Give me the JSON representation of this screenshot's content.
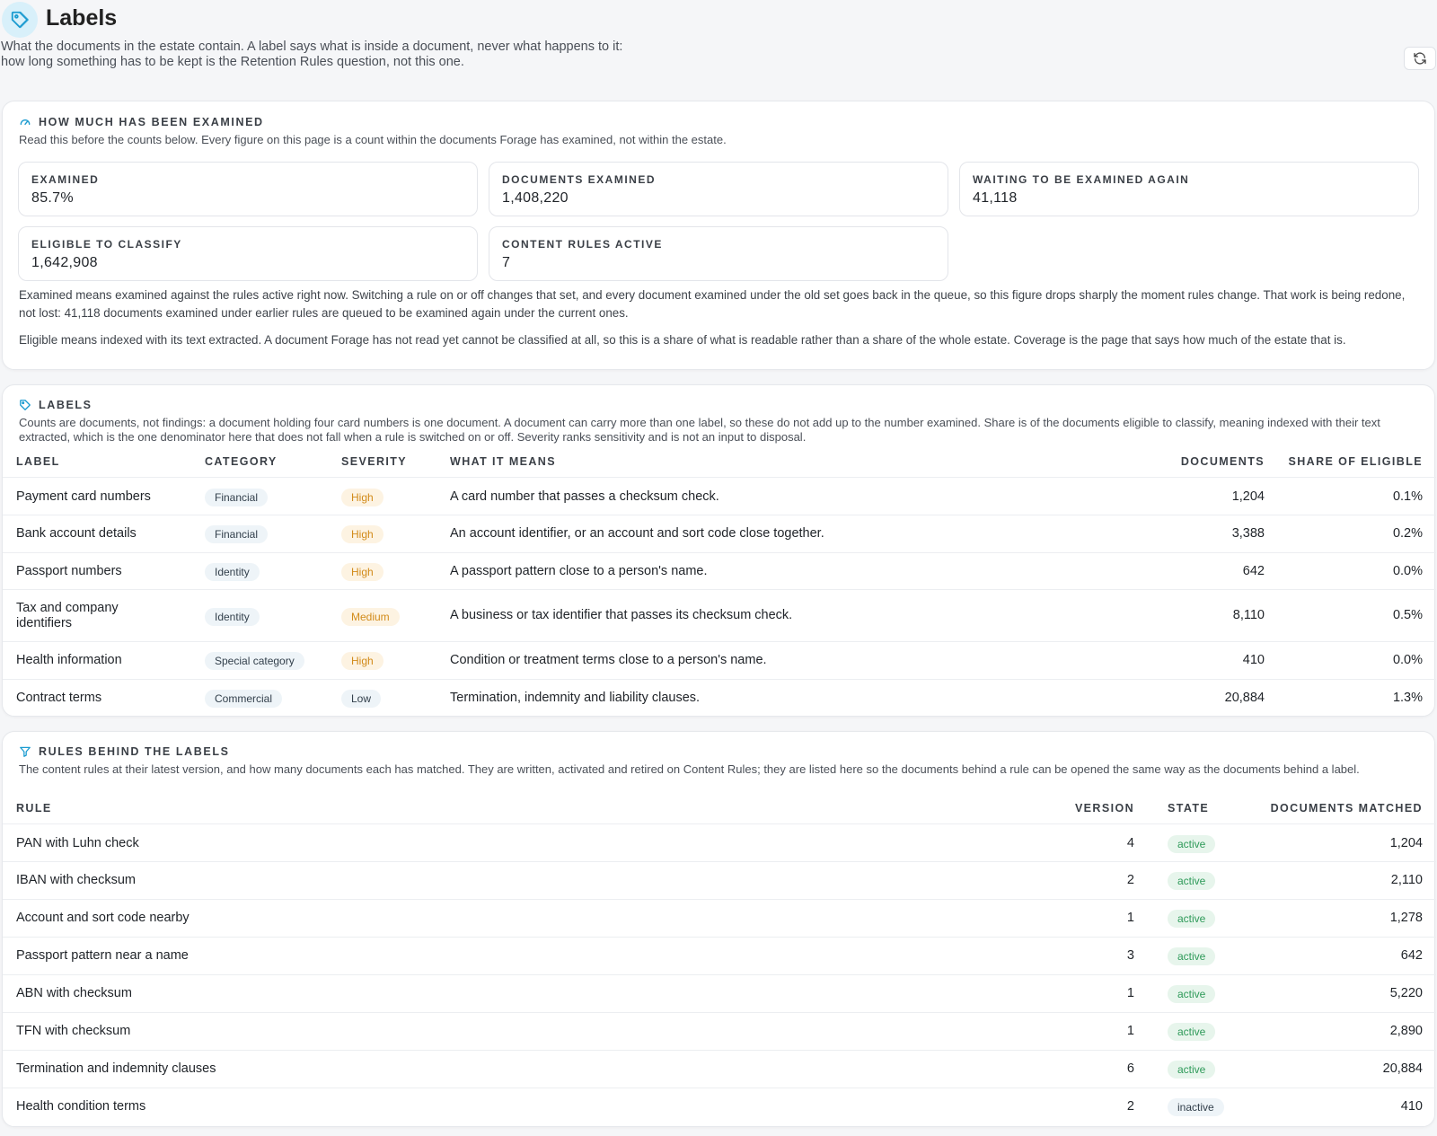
{
  "page": {
    "title": "Labels",
    "description": "What the documents in the estate contain. A label says what is inside a document, never what happens to it: how long something has to be kept is the Retention Rules question, not this one."
  },
  "examined": {
    "title": "HOW MUCH HAS BEEN EXAMINED",
    "subtitle": "Read this before the counts below. Every figure on this page is a count within the documents Forage has examined, not within the estate.",
    "stats": [
      {
        "label": "EXAMINED",
        "value": "85.7%"
      },
      {
        "label": "DOCUMENTS EXAMINED",
        "value": "1,408,220"
      },
      {
        "label": "WAITING TO BE EXAMINED AGAIN",
        "value": "41,118"
      },
      {
        "label": "ELIGIBLE TO CLASSIFY",
        "value": "1,642,908"
      },
      {
        "label": "CONTENT RULES ACTIVE",
        "value": "7"
      }
    ],
    "note1": "Examined means examined against the rules active right now. Switching a rule on or off changes that set, and every document examined under the old set goes back in the queue, so this figure drops sharply the moment rules change. That work is being redone, not lost: 41,118 documents examined under earlier rules are queued to be examined again under the current ones.",
    "note2": "Eligible means indexed with its text extracted. A document Forage has not read yet cannot be classified at all, so this is a share of what is readable rather than a share of the whole estate. Coverage is the page that says how much of the estate that is."
  },
  "labels": {
    "title": "LABELS",
    "subtitle": "Counts are documents, not findings: a document holding four card numbers is one document. A document can carry more than one label, so these do not add up to the number examined. Share is of the documents eligible to classify, meaning indexed with their text extracted, which is the one denominator here that does not fall when a rule is switched on or off. Severity ranks sensitivity and is not an input to disposal.",
    "columns": {
      "label": "LABEL",
      "category": "CATEGORY",
      "severity": "SEVERITY",
      "meaning": "WHAT IT MEANS",
      "documents": "DOCUMENTS",
      "share": "SHARE OF ELIGIBLE"
    },
    "rows": [
      {
        "label": "Payment card numbers",
        "category": "Financial",
        "severity": "High",
        "meaning": "A card number that passes a checksum check.",
        "documents": "1,204",
        "share": "0.1%"
      },
      {
        "label": "Bank account details",
        "category": "Financial",
        "severity": "High",
        "meaning": "An account identifier, or an account and sort code close together.",
        "documents": "3,388",
        "share": "0.2%"
      },
      {
        "label": "Passport numbers",
        "category": "Identity",
        "severity": "High",
        "meaning": "A passport pattern close to a person's name.",
        "documents": "642",
        "share": "0.0%"
      },
      {
        "label": "Tax and company identifiers",
        "category": "Identity",
        "severity": "Medium",
        "meaning": "A business or tax identifier that passes its checksum check.",
        "documents": "8,110",
        "share": "0.5%"
      },
      {
        "label": "Health information",
        "category": "Special category",
        "severity": "High",
        "meaning": "Condition or treatment terms close to a person's name.",
        "documents": "410",
        "share": "0.0%"
      },
      {
        "label": "Contract terms",
        "category": "Commercial",
        "severity": "Low",
        "meaning": "Termination, indemnity and liability clauses.",
        "documents": "20,884",
        "share": "1.3%"
      }
    ]
  },
  "rules": {
    "title": "RULES BEHIND THE LABELS",
    "subtitle": "The content rules at their latest version, and how many documents each has matched. They are written, activated and retired on Content Rules; they are listed here so the documents behind a rule can be opened the same way as the documents behind a label.",
    "columns": {
      "rule": "RULE",
      "version": "VERSION",
      "state": "STATE",
      "matched": "DOCUMENTS MATCHED"
    },
    "rows": [
      {
        "rule": "PAN with Luhn check",
        "version": "4",
        "state": "active",
        "matched": "1,204"
      },
      {
        "rule": "IBAN with checksum",
        "version": "2",
        "state": "active",
        "matched": "2,110"
      },
      {
        "rule": "Account and sort code nearby",
        "version": "1",
        "state": "active",
        "matched": "1,278"
      },
      {
        "rule": "Passport pattern near a name",
        "version": "3",
        "state": "active",
        "matched": "642"
      },
      {
        "rule": "ABN with checksum",
        "version": "1",
        "state": "active",
        "matched": "5,220"
      },
      {
        "rule": "TFN with checksum",
        "version": "1",
        "state": "active",
        "matched": "2,890"
      },
      {
        "rule": "Termination and indemnity clauses",
        "version": "6",
        "state": "active",
        "matched": "20,884"
      },
      {
        "rule": "Health condition terms",
        "version": "2",
        "state": "inactive",
        "matched": "410"
      }
    ]
  },
  "colors": {
    "accent": "#1a9bd0",
    "high": "#d28b1a",
    "active": "#2e9a59"
  }
}
